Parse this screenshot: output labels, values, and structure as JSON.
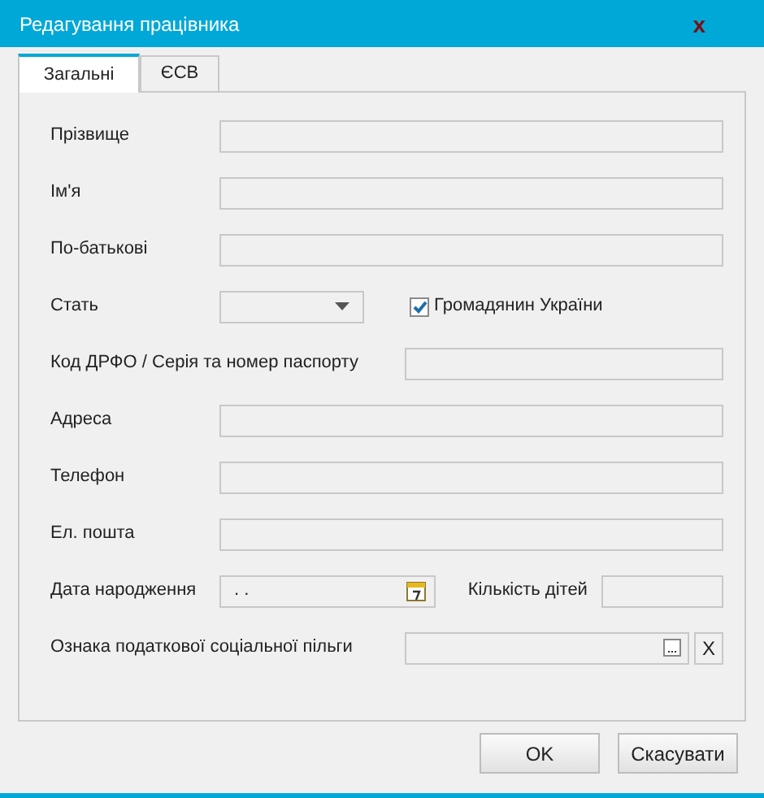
{
  "window": {
    "title": "Редагування працівника",
    "close": "x"
  },
  "tabs": [
    {
      "label": "Загальні",
      "selected": true
    },
    {
      "label": "ЄСВ",
      "selected": false
    }
  ],
  "fields": [
    {
      "kind": "text",
      "label": "Прізвище"
    },
    {
      "kind": "text",
      "label": "Ім'я"
    },
    {
      "kind": "text",
      "label": "По-батькові"
    },
    {
      "kind": "select",
      "label": "Стать",
      "checkbox": {
        "label": "Громадянин України",
        "checked": true
      }
    },
    {
      "kind": "code",
      "label": "Код ДРФО / Серія та номер паспорту"
    },
    {
      "kind": "text",
      "label": "Адреса"
    },
    {
      "kind": "text",
      "label": "Телефон"
    },
    {
      "kind": "text",
      "label": "Ел. пошта"
    },
    {
      "kind": "date",
      "label": "Дата народження",
      "value": ". .",
      "extra_label": "Кількість дітей"
    },
    {
      "kind": "lookup",
      "label": "Ознака податкової соціальної пільги",
      "clear": "X"
    }
  ],
  "buttons": [
    "OK",
    "Скасувати"
  ]
}
